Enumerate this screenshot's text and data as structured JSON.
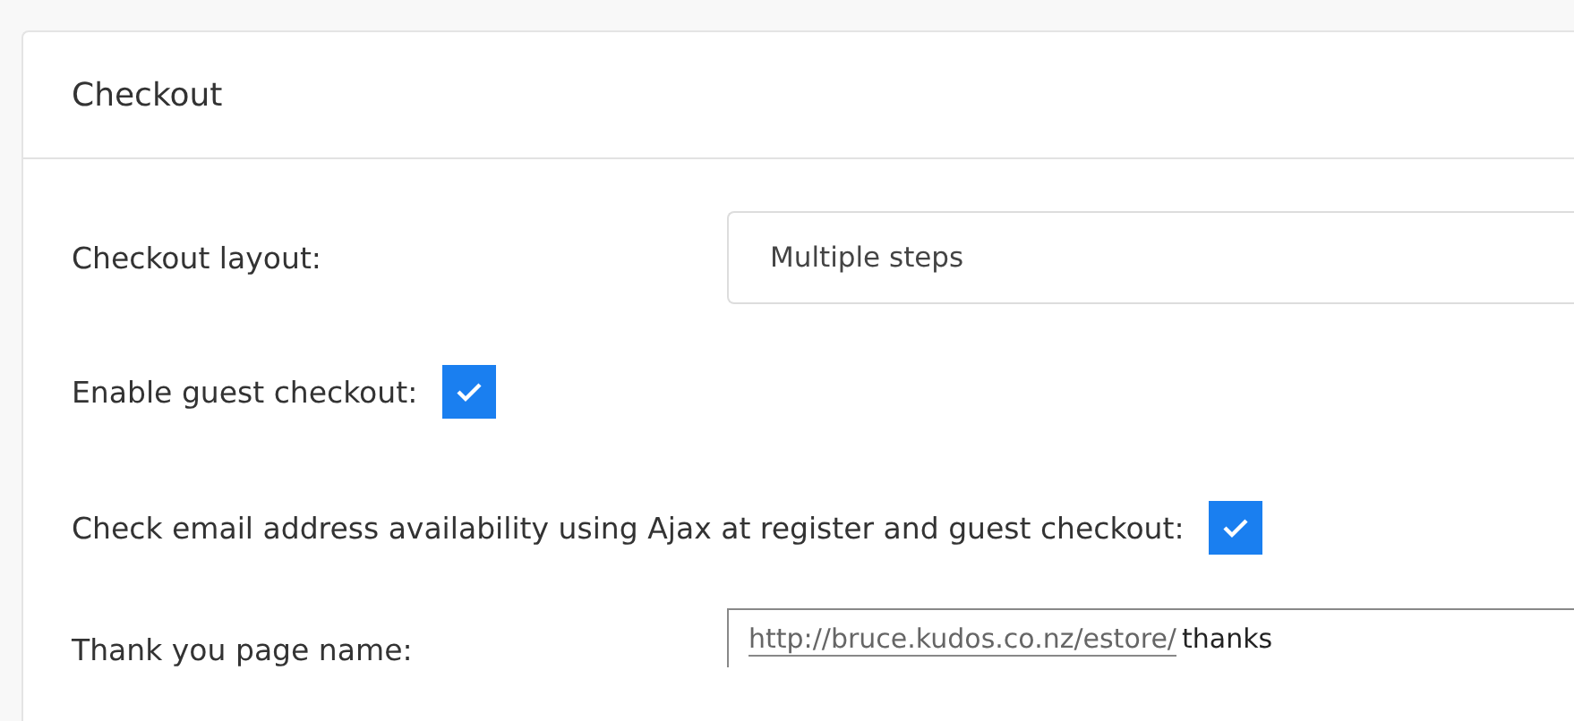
{
  "card": {
    "title": "Checkout"
  },
  "fields": [
    {
      "kind": "select",
      "label": "Checkout layout:",
      "value": "Multiple steps"
    },
    {
      "kind": "checkbox",
      "label": "Enable guest checkout:",
      "checked": true
    },
    {
      "kind": "checkbox",
      "label": "Check email address availability using Ajax at register and guest checkout:",
      "checked": true
    },
    {
      "kind": "url",
      "label": "Thank you page name:",
      "prefix": "http://bruce.kudos.co.nz/estore/",
      "value": "thanks"
    }
  ]
}
